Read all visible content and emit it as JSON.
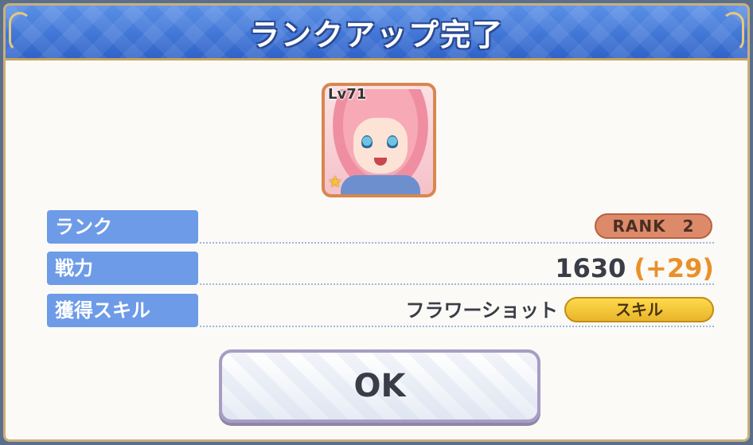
{
  "dialog": {
    "title": "ランクアップ完了"
  },
  "character": {
    "level": "Lv71",
    "stars": "★"
  },
  "stats": {
    "rank": {
      "label": "ランク",
      "value": "RANK　2"
    },
    "power": {
      "label": "戦力",
      "value": "1630",
      "gain": "(+29)"
    },
    "skill": {
      "label": "獲得スキル",
      "name": "フラワーショット",
      "tag": "スキル"
    }
  },
  "buttons": {
    "ok": "OK"
  },
  "colors": {
    "header_blue": "#3f75d8",
    "label_blue": "#6d9be8",
    "rank_badge": "#dd8a6b",
    "skill_tag": "#f3c530",
    "gain_orange": "#e9902a"
  }
}
